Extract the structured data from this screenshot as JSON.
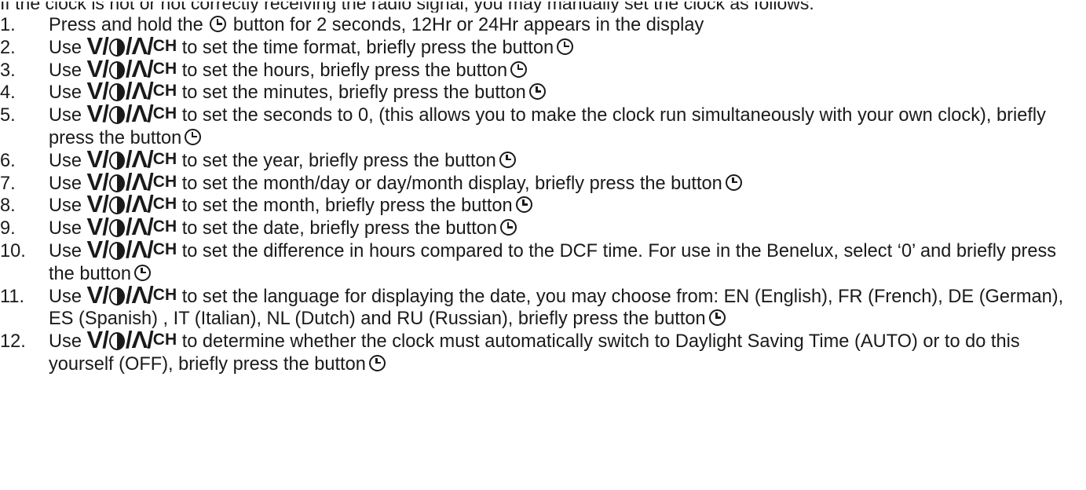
{
  "intro": "If the clock is not or not correctly receiving the radio signal, you may manually set the clock as follows:",
  "symbols": {
    "down": "V",
    "light": "half-circle-icon",
    "up": "Λ",
    "channel": "CH",
    "separator": "/",
    "set_button": "clock-icon"
  },
  "step1": {
    "num": "1.",
    "before": "Press and hold the",
    "after": "button for 2 seconds, 12Hr or 24Hr appears in the display"
  },
  "steps": [
    {
      "num": "2.",
      "text": "to set the time format, briefly press the button"
    },
    {
      "num": "3.",
      "text": "to set the hours, briefly press the button"
    },
    {
      "num": "4.",
      "text": "to set the minutes, briefly press the button"
    },
    {
      "num": "5.",
      "text": "to set the seconds to 0, (this allows you to make the clock run simultaneously with your own clock), briefly press the button"
    },
    {
      "num": "6.",
      "text": "to set the year, briefly press the button"
    },
    {
      "num": "7.",
      "text": "to set the month/day or day/month display, briefly press the button"
    },
    {
      "num": "8.",
      "text": "to set the month, briefly press the button"
    },
    {
      "num": "9.",
      "text": "to set the date, briefly press the button"
    },
    {
      "num": "10.",
      "text": "to set the difference in hours compared to the DCF time. For use in the Benelux, select ‘0’ and briefly press the button"
    },
    {
      "num": "11.",
      "text": "to set the language for displaying the date, you may choose from: EN (English), FR (French), DE (German), ES (Spanish) , IT (Italian), NL (Dutch) and RU (Russian), briefly press the button"
    },
    {
      "num": "12.",
      "text": "to determine whether the clock must automatically switch to Daylight Saving Time (AUTO) or to do this yourself (OFF), briefly press the button"
    }
  ],
  "use_word": "Use"
}
